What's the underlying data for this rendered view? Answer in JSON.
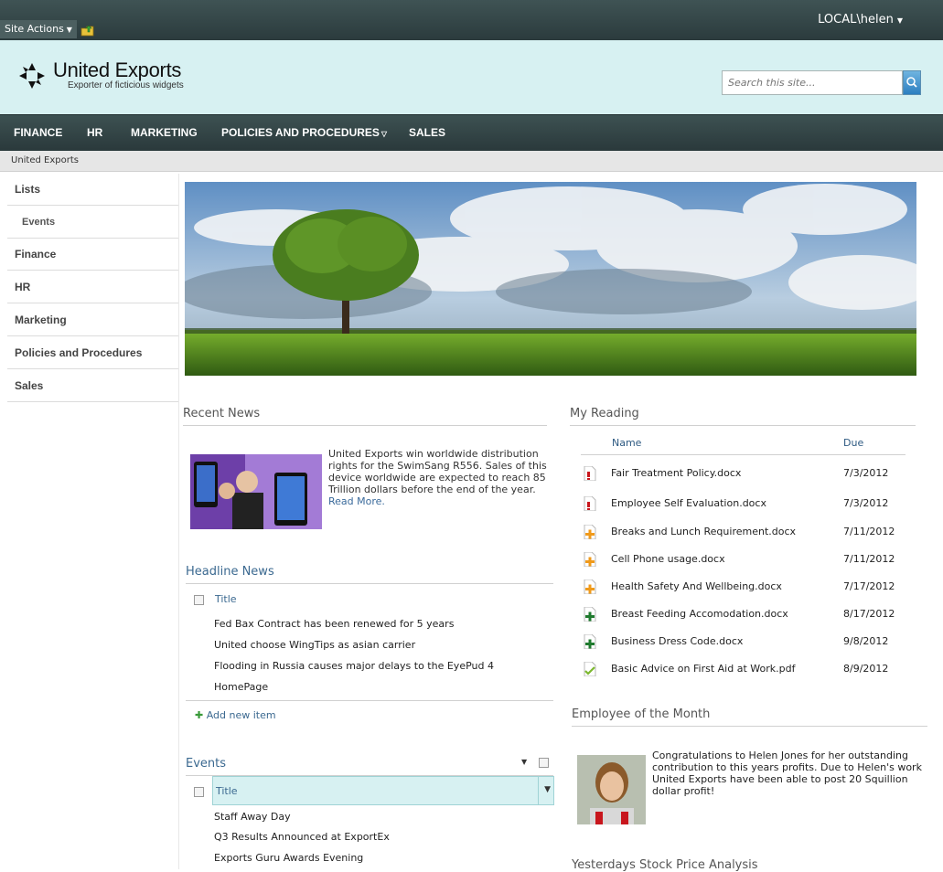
{
  "ribbon": {
    "site_actions": "Site Actions",
    "user": "LOCAL\\helen"
  },
  "header": {
    "title": "United Exports",
    "subtitle": "Exporter of ficticious widgets",
    "search_placeholder": "Search this site..."
  },
  "topnav": {
    "items": [
      "FINANCE",
      "HR",
      "MARKETING",
      "POLICIES AND PROCEDURES",
      "SALES"
    ]
  },
  "breadcrumb": "United Exports",
  "leftnav": {
    "items": [
      "Lists",
      "Events",
      "Finance",
      "HR",
      "Marketing",
      "Policies and Procedures",
      "Sales"
    ]
  },
  "recent_news": {
    "title": "Recent News",
    "text": "United Exports win worldwide distribution rights for the SwimSang R556. Sales of this device worldwide are expected to reach 85 Trillion dollars before the end of the year.",
    "read_more": "Read More."
  },
  "headline_news": {
    "title": "Headline News",
    "column": "Title",
    "items": [
      "Fed Bax Contract has been renewed for 5 years",
      "United choose WingTips as asian carrier",
      "Flooding in Russia causes major delays to the EyePud 4",
      "HomePage"
    ],
    "add_new": "Add new item"
  },
  "events": {
    "title": "Events",
    "column": "Title",
    "items": [
      "Staff Away Day",
      "Q3 Results Announced at ExportEx",
      "Exports Guru Awards Evening"
    ]
  },
  "my_reading": {
    "title": "My Reading",
    "col_name": "Name",
    "col_due": "Due",
    "items": [
      {
        "name": "Fair Treatment Policy.docx",
        "due": "7/3/2012",
        "icon": "priority-high-icon"
      },
      {
        "name": "Employee Self Evaluation.docx",
        "due": "7/3/2012",
        "icon": "priority-high-icon"
      },
      {
        "name": "Breaks and Lunch Requirement.docx",
        "due": "7/11/2012",
        "icon": "priority-medium-icon"
      },
      {
        "name": "Cell Phone usage.docx",
        "due": "7/11/2012",
        "icon": "priority-medium-icon"
      },
      {
        "name": "Health Safety And Wellbeing.docx",
        "due": "7/17/2012",
        "icon": "priority-medium-icon"
      },
      {
        "name": "Breast Feeding Accomodation.docx",
        "due": "8/17/2012",
        "icon": "priority-low-icon"
      },
      {
        "name": "Business Dress Code.docx",
        "due": "9/8/2012",
        "icon": "priority-low-icon"
      },
      {
        "name": "Basic Advice on First Aid at Work.pdf",
        "due": "8/9/2012",
        "icon": "completed-check-icon"
      }
    ]
  },
  "employee": {
    "title": "Employee of the Month",
    "text": "Congratulations to Helen Jones for her outstanding contribution to this years profits. Due to Helen's work United Exports have been able to post 20 Squillion dollar profit!"
  },
  "stock": {
    "title": "Yesterdays Stock Price Analysis"
  },
  "colors": {
    "header_bg": "#d7f1f2",
    "nav_bg": "#2f4042",
    "link": "#3b6990"
  }
}
